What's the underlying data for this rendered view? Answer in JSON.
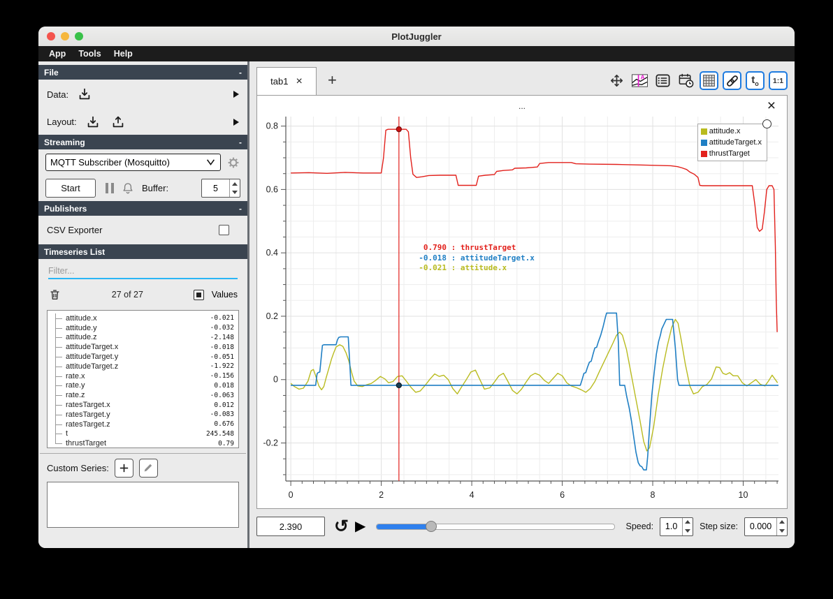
{
  "window": {
    "title": "PlotJuggler"
  },
  "menu": {
    "items": [
      "App",
      "Tools",
      "Help"
    ]
  },
  "sidebar": {
    "file": {
      "title": "File",
      "collapse": "-",
      "data_label": "Data:",
      "layout_label": "Layout:"
    },
    "streaming": {
      "title": "Streaming",
      "collapse": "-",
      "source_value": "MQTT Subscriber (Mosquitto)",
      "start_label": "Start",
      "buffer_label": "Buffer:",
      "buffer_value": "5"
    },
    "publishers": {
      "title": "Publishers",
      "collapse": "-",
      "csv_label": "CSV Exporter",
      "csv_checked": false
    },
    "timeseries": {
      "title": "Timeseries List",
      "filter_placeholder": "Filter...",
      "count_text": "27 of 27",
      "values_label": "Values",
      "values_checked": true,
      "items": [
        {
          "name": "attitude.x",
          "value": "-0.021"
        },
        {
          "name": "attitude.y",
          "value": "-0.032"
        },
        {
          "name": "attitude.z",
          "value": "-2.148"
        },
        {
          "name": "attitudeTarget.x",
          "value": "-0.018"
        },
        {
          "name": "attitudeTarget.y",
          "value": "-0.051"
        },
        {
          "name": "attitudeTarget.z",
          "value": "-1.922"
        },
        {
          "name": "rate.x",
          "value": "-0.156"
        },
        {
          "name": "rate.y",
          "value": "0.018"
        },
        {
          "name": "rate.z",
          "value": "-0.063"
        },
        {
          "name": "ratesTarget.x",
          "value": "0.012"
        },
        {
          "name": "ratesTarget.y",
          "value": "-0.083"
        },
        {
          "name": "ratesTarget.z",
          "value": "0.676"
        },
        {
          "name": "t",
          "value": "245.548"
        },
        {
          "name": "thrustTarget",
          "value": "0.79"
        }
      ],
      "custom_series_label": "Custom Series:"
    }
  },
  "tabs": {
    "active_label": "tab1",
    "close_glyph": "×",
    "add_glyph": "+"
  },
  "toolbar": {
    "active_color": "#1e7be0",
    "buttons": [
      {
        "id": "pan-zoom",
        "active": false
      },
      {
        "id": "curve-tracker",
        "active": false
      },
      {
        "id": "plot-list",
        "active": false
      },
      {
        "id": "datetime",
        "active": false
      },
      {
        "id": "grid-layout",
        "active": true
      },
      {
        "id": "link-axes",
        "active": true
      },
      {
        "id": "time-offset",
        "active": true,
        "text": "to"
      },
      {
        "id": "ratio",
        "active": true,
        "text": "1:1"
      }
    ]
  },
  "plot": {
    "title": "...",
    "close_glyph": "×",
    "legend": [
      {
        "label": "attitude.x",
        "color": "#b9bb1f"
      },
      {
        "label": "attitudeTarget.x",
        "color": "#1f7fc4"
      },
      {
        "label": "thrustTarget",
        "color": "#e2211c"
      }
    ],
    "tracker_readout": [
      {
        "value": "0.790",
        "label": "thrustTarget",
        "color": "#e2211c"
      },
      {
        "value": "-0.018",
        "label": "attitudeTarget.x",
        "color": "#1f7fc4"
      },
      {
        "value": "-0.021",
        "label": "attitude.x",
        "color": "#b9bb1f"
      }
    ]
  },
  "chart_data": {
    "type": "line",
    "title": "...",
    "xlabel": "",
    "ylabel": "",
    "xlim": [
      -0.11,
      10.78
    ],
    "ylim": [
      -0.32,
      0.83
    ],
    "x_ticks": [
      0,
      2,
      4,
      6,
      8,
      10
    ],
    "y_ticks": [
      -0.2,
      0,
      0.2,
      0.4,
      0.6,
      0.8
    ],
    "x_minor_step": 0.25,
    "y_minor_step": 0.05,
    "grid": true,
    "legend_position": "top-right",
    "tracker": {
      "x": 2.39,
      "color": "#e2211c",
      "points": [
        {
          "y": 0.79,
          "fill": "#cc1111",
          "ring": "#7a0c0c"
        },
        {
          "y": -0.018,
          "fill": "#1b3d52",
          "ring": "#0b1d29"
        }
      ]
    },
    "series": [
      {
        "name": "attitude.x",
        "color": "#b9bb1f",
        "width": 1.4,
        "points": [
          [
            0,
            -0.012
          ],
          [
            0.08,
            -0.022
          ],
          [
            0.18,
            -0.03
          ],
          [
            0.28,
            -0.027
          ],
          [
            0.38,
            -0.005
          ],
          [
            0.45,
            0.028
          ],
          [
            0.5,
            0.032
          ],
          [
            0.55,
            0.012
          ],
          [
            0.62,
            -0.02
          ],
          [
            0.68,
            -0.032
          ],
          [
            0.73,
            -0.022
          ],
          [
            0.78,
            0.005
          ],
          [
            0.84,
            0.035
          ],
          [
            0.9,
            0.065
          ],
          [
            0.95,
            0.085
          ],
          [
            1.0,
            0.103
          ],
          [
            1.08,
            0.11
          ],
          [
            1.15,
            0.105
          ],
          [
            1.22,
            0.085
          ],
          [
            1.28,
            0.06
          ],
          [
            1.34,
            0.025
          ],
          [
            1.4,
            -0.005
          ],
          [
            1.48,
            -0.02
          ],
          [
            1.58,
            -0.022
          ],
          [
            1.68,
            -0.016
          ],
          [
            1.78,
            -0.012
          ],
          [
            1.88,
            -0.002
          ],
          [
            1.98,
            0.01
          ],
          [
            2.08,
            0.002
          ],
          [
            2.16,
            -0.01
          ],
          [
            2.26,
            -0.006
          ],
          [
            2.36,
            0.01
          ],
          [
            2.46,
            0.012
          ],
          [
            2.56,
            -0.006
          ],
          [
            2.66,
            -0.025
          ],
          [
            2.76,
            -0.04
          ],
          [
            2.86,
            -0.036
          ],
          [
            2.96,
            -0.02
          ],
          [
            3.08,
            0.002
          ],
          [
            3.18,
            0.018
          ],
          [
            3.28,
            0.01
          ],
          [
            3.38,
            0.014
          ],
          [
            3.48,
            0
          ],
          [
            3.58,
            -0.028
          ],
          [
            3.68,
            -0.045
          ],
          [
            3.78,
            -0.022
          ],
          [
            3.88,
            0
          ],
          [
            3.98,
            0.024
          ],
          [
            4.08,
            0.03
          ],
          [
            4.18,
            0
          ],
          [
            4.28,
            -0.03
          ],
          [
            4.4,
            -0.026
          ],
          [
            4.5,
            -0.008
          ],
          [
            4.6,
            0.012
          ],
          [
            4.7,
            0.02
          ],
          [
            4.8,
            -0.006
          ],
          [
            4.9,
            -0.034
          ],
          [
            5.0,
            -0.045
          ],
          [
            5.1,
            -0.03
          ],
          [
            5.2,
            -0.008
          ],
          [
            5.3,
            0.012
          ],
          [
            5.4,
            0.02
          ],
          [
            5.5,
            0.014
          ],
          [
            5.6,
            -0.002
          ],
          [
            5.7,
            -0.012
          ],
          [
            5.8,
            0.004
          ],
          [
            5.9,
            0.02
          ],
          [
            6.0,
            0.012
          ],
          [
            6.1,
            -0.01
          ],
          [
            6.2,
            -0.02
          ],
          [
            6.32,
            -0.026
          ],
          [
            6.42,
            -0.032
          ],
          [
            6.52,
            -0.04
          ],
          [
            6.62,
            -0.028
          ],
          [
            6.72,
            -0.006
          ],
          [
            6.82,
            0.025
          ],
          [
            6.92,
            0.055
          ],
          [
            7.02,
            0.085
          ],
          [
            7.12,
            0.115
          ],
          [
            7.2,
            0.14
          ],
          [
            7.27,
            0.15
          ],
          [
            7.33,
            0.14
          ],
          [
            7.42,
            0.095
          ],
          [
            7.52,
            0.02
          ],
          [
            7.62,
            -0.055
          ],
          [
            7.72,
            -0.13
          ],
          [
            7.8,
            -0.195
          ],
          [
            7.87,
            -0.225
          ],
          [
            7.93,
            -0.215
          ],
          [
            8.02,
            -0.15
          ],
          [
            8.12,
            -0.05
          ],
          [
            8.22,
            0.035
          ],
          [
            8.32,
            0.105
          ],
          [
            8.42,
            0.165
          ],
          [
            8.5,
            0.19
          ],
          [
            8.56,
            0.178
          ],
          [
            8.63,
            0.125
          ],
          [
            8.72,
            0.05
          ],
          [
            8.82,
            -0.02
          ],
          [
            8.9,
            -0.045
          ],
          [
            9.0,
            -0.04
          ],
          [
            9.1,
            -0.022
          ],
          [
            9.2,
            -0.015
          ],
          [
            9.3,
            0.002
          ],
          [
            9.4,
            0.04
          ],
          [
            9.48,
            0.038
          ],
          [
            9.55,
            0.02
          ],
          [
            9.62,
            0.016
          ],
          [
            9.7,
            0.022
          ],
          [
            9.78,
            0.012
          ],
          [
            9.88,
            0.012
          ],
          [
            9.98,
            -0.01
          ],
          [
            10.08,
            -0.02
          ],
          [
            10.18,
            -0.01
          ],
          [
            10.28,
            0
          ],
          [
            10.38,
            -0.015
          ],
          [
            10.48,
            -0.02
          ],
          [
            10.56,
            -0.004
          ],
          [
            10.64,
            0.014
          ],
          [
            10.7,
            0.002
          ],
          [
            10.76,
            -0.01
          ]
        ]
      },
      {
        "name": "attitudeTarget.x",
        "color": "#1f7fc4",
        "width": 1.6,
        "points": [
          [
            0,
            -0.018
          ],
          [
            0.55,
            -0.018
          ],
          [
            0.58,
            0.018
          ],
          [
            0.6,
            0.022
          ],
          [
            0.64,
            0.024
          ],
          [
            0.66,
            0.05
          ],
          [
            0.68,
            0.08
          ],
          [
            0.7,
            0.108
          ],
          [
            0.73,
            0.11
          ],
          [
            1.0,
            0.11
          ],
          [
            1.03,
            0.125
          ],
          [
            1.06,
            0.133
          ],
          [
            1.1,
            0.135
          ],
          [
            1.27,
            0.135
          ],
          [
            1.3,
            0.06
          ],
          [
            1.33,
            -0.018
          ],
          [
            6.4,
            -0.018
          ],
          [
            6.44,
            0
          ],
          [
            6.48,
            0.02
          ],
          [
            6.52,
            0.022
          ],
          [
            6.56,
            0.04
          ],
          [
            6.6,
            0.055
          ],
          [
            6.64,
            0.058
          ],
          [
            6.68,
            0.08
          ],
          [
            6.72,
            0.1
          ],
          [
            6.76,
            0.102
          ],
          [
            6.8,
            0.12
          ],
          [
            6.85,
            0.14
          ],
          [
            6.9,
            0.165
          ],
          [
            6.95,
            0.195
          ],
          [
            6.98,
            0.21
          ],
          [
            7.2,
            0.21
          ],
          [
            7.24,
            0.12
          ],
          [
            7.27,
            -0.018
          ],
          [
            7.38,
            -0.018
          ],
          [
            7.42,
            -0.05
          ],
          [
            7.48,
            -0.09
          ],
          [
            7.53,
            -0.13
          ],
          [
            7.58,
            -0.18
          ],
          [
            7.63,
            -0.23
          ],
          [
            7.68,
            -0.262
          ],
          [
            7.72,
            -0.272
          ],
          [
            7.76,
            -0.275
          ],
          [
            7.8,
            -0.285
          ],
          [
            7.86,
            -0.285
          ],
          [
            7.89,
            -0.24
          ],
          [
            7.93,
            -0.15
          ],
          [
            7.98,
            -0.05
          ],
          [
            8.03,
            0.02
          ],
          [
            8.08,
            0.08
          ],
          [
            8.13,
            0.12
          ],
          [
            8.17,
            0.14
          ],
          [
            8.2,
            0.16
          ],
          [
            8.25,
            0.175
          ],
          [
            8.3,
            0.19
          ],
          [
            8.44,
            0.19
          ],
          [
            8.5,
            0.1
          ],
          [
            8.55,
            0
          ],
          [
            8.58,
            -0.018
          ],
          [
            10.78,
            -0.018
          ]
        ]
      },
      {
        "name": "thrustTarget",
        "color": "#e2211c",
        "width": 1.4,
        "points": [
          [
            0,
            0.652
          ],
          [
            0.4,
            0.653
          ],
          [
            0.8,
            0.651
          ],
          [
            1.2,
            0.654
          ],
          [
            1.6,
            0.652
          ],
          [
            2.0,
            0.652
          ],
          [
            2.05,
            0.7
          ],
          [
            2.1,
            0.787
          ],
          [
            2.15,
            0.79
          ],
          [
            2.55,
            0.79
          ],
          [
            2.6,
            0.782
          ],
          [
            2.65,
            0.7
          ],
          [
            2.7,
            0.648
          ],
          [
            2.78,
            0.638
          ],
          [
            2.9,
            0.64
          ],
          [
            3.05,
            0.644
          ],
          [
            3.3,
            0.645
          ],
          [
            3.65,
            0.645
          ],
          [
            3.7,
            0.613
          ],
          [
            4.1,
            0.613
          ],
          [
            4.15,
            0.642
          ],
          [
            4.3,
            0.645
          ],
          [
            4.5,
            0.647
          ],
          [
            4.55,
            0.657
          ],
          [
            4.7,
            0.66
          ],
          [
            4.9,
            0.662
          ],
          [
            4.95,
            0.667
          ],
          [
            5.2,
            0.668
          ],
          [
            5.45,
            0.671
          ],
          [
            5.5,
            0.682
          ],
          [
            5.7,
            0.685
          ],
          [
            6.2,
            0.685
          ],
          [
            6.3,
            0.681
          ],
          [
            6.6,
            0.68
          ],
          [
            7.2,
            0.679
          ],
          [
            7.8,
            0.677
          ],
          [
            8.4,
            0.675
          ],
          [
            8.55,
            0.672
          ],
          [
            8.65,
            0.668
          ],
          [
            8.75,
            0.663
          ],
          [
            8.82,
            0.655
          ],
          [
            8.92,
            0.648
          ],
          [
            9.0,
            0.638
          ],
          [
            9.04,
            0.613
          ],
          [
            9.1,
            0.612
          ],
          [
            10.2,
            0.612
          ],
          [
            10.26,
            0.55
          ],
          [
            10.31,
            0.48
          ],
          [
            10.36,
            0.468
          ],
          [
            10.42,
            0.475
          ],
          [
            10.47,
            0.53
          ],
          [
            10.52,
            0.6
          ],
          [
            10.57,
            0.612
          ],
          [
            10.64,
            0.612
          ],
          [
            10.68,
            0.6
          ],
          [
            10.71,
            0.42
          ],
          [
            10.73,
            0.25
          ],
          [
            10.75,
            0.15
          ]
        ]
      }
    ]
  },
  "playback": {
    "time": "2.390",
    "loop_glyph": "↺",
    "play_glyph": "▶",
    "slider_fraction": 0.23,
    "speed_label": "Speed:",
    "speed_value": "1.0",
    "step_label": "Step size:",
    "step_value": "0.000"
  }
}
